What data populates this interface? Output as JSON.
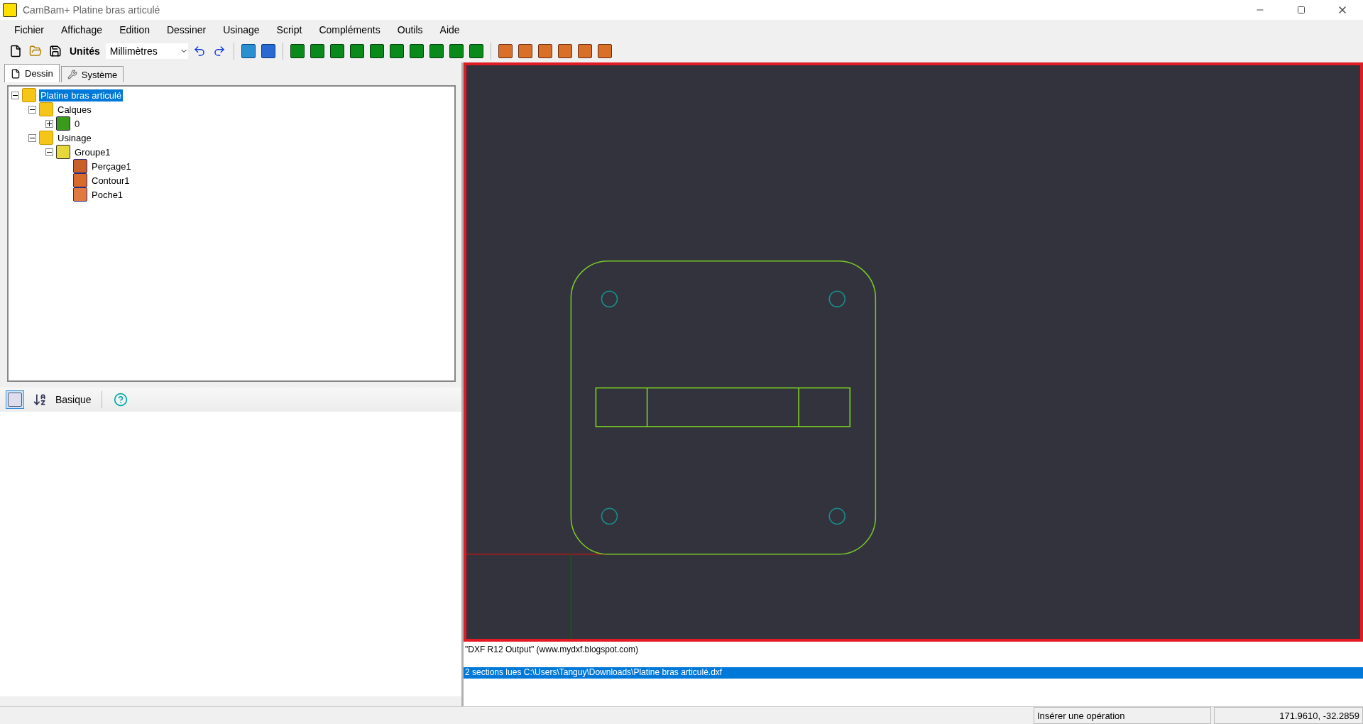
{
  "window": {
    "title": "CamBam+  Platine bras articulé"
  },
  "menu": [
    "Fichier",
    "Affichage",
    "Edition",
    "Dessiner",
    "Usinage",
    "Script",
    "Compléments",
    "Outils",
    "Aide"
  ],
  "toolbar": {
    "units_label": "Unités",
    "units_value": "Millimètres"
  },
  "panel_tabs": [
    {
      "label": "Dessin",
      "selected": true
    },
    {
      "label": "Système",
      "selected": false
    }
  ],
  "tree": [
    {
      "label": "Platine bras articulé",
      "kind": "folder",
      "selected": true,
      "expanded": true,
      "children": [
        {
          "label": "Calques",
          "kind": "folder",
          "selected": false,
          "expanded": true,
          "children": [
            {
              "label": "0",
              "kind": "layer",
              "selected": false,
              "expanded": false
            }
          ]
        },
        {
          "label": "Usinage",
          "kind": "folder",
          "selected": false,
          "expanded": true,
          "children": [
            {
              "label": "Groupe1",
              "kind": "group",
              "selected": false,
              "expanded": true,
              "children": [
                {
                  "label": "Perçage1",
                  "kind": "drill",
                  "selected": false
                },
                {
                  "label": "Contour1",
                  "kind": "profile",
                  "selected": false
                },
                {
                  "label": "Poche1",
                  "kind": "pocket",
                  "selected": false
                }
              ]
            }
          ]
        }
      ]
    }
  ],
  "properties_toolbar": {
    "categorized": true,
    "filter_label": "Basique"
  },
  "log": [
    {
      "text": "\"DXF R12 Output\" (www.mydxf.blogspot.com)",
      "selected": false
    },
    {
      "text": "2 sections lues C:\\Users\\Tanguy\\Downloads\\Platine bras articulé.dxf",
      "selected": true
    }
  ],
  "status_bar": [
    "Insérer une opération",
    "171.9610, -32.2859"
  ]
}
